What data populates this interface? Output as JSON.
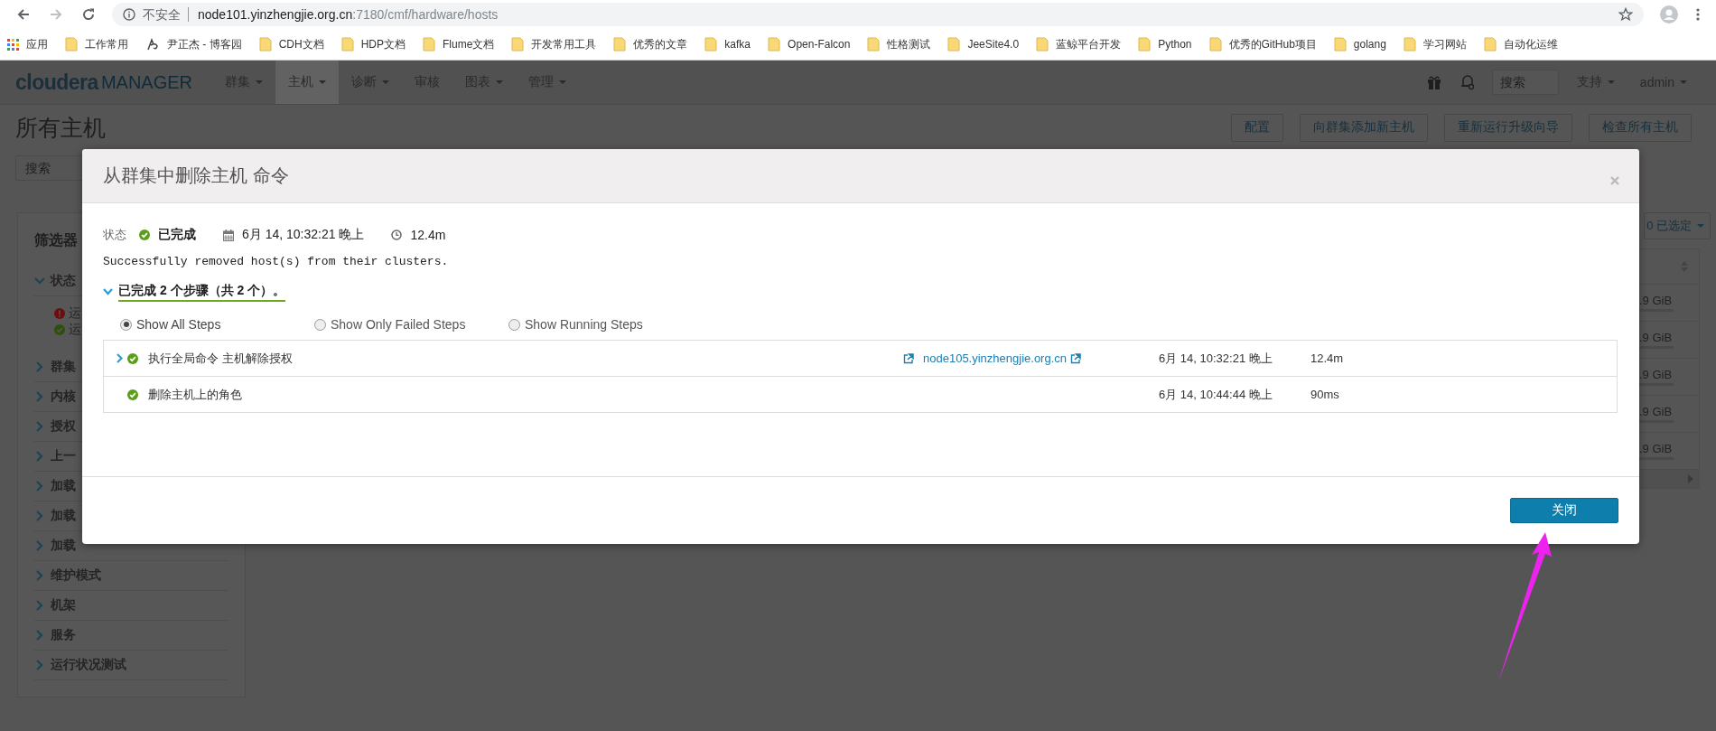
{
  "browser": {
    "address_bar": {
      "security_label": "不安全",
      "host": "node101.yinzhengjie.org.cn",
      "path": ":7180/cmf/hardware/hosts"
    },
    "bookmarks": [
      {
        "label": "应用",
        "kind": "apps"
      },
      {
        "label": "工作常用",
        "kind": "folder"
      },
      {
        "label": "尹正杰 - 博客园",
        "kind": "site"
      },
      {
        "label": "CDH文档",
        "kind": "folder"
      },
      {
        "label": "HDP文档",
        "kind": "folder"
      },
      {
        "label": "Flume文档",
        "kind": "folder"
      },
      {
        "label": "开发常用工具",
        "kind": "folder"
      },
      {
        "label": "优秀的文章",
        "kind": "folder"
      },
      {
        "label": "kafka",
        "kind": "folder"
      },
      {
        "label": "Open-Falcon",
        "kind": "folder"
      },
      {
        "label": "性格测试",
        "kind": "folder"
      },
      {
        "label": "JeeSite4.0",
        "kind": "folder"
      },
      {
        "label": "蓝鲸平台开发",
        "kind": "folder"
      },
      {
        "label": "Python",
        "kind": "folder"
      },
      {
        "label": "优秀的GitHub项目",
        "kind": "folder"
      },
      {
        "label": "golang",
        "kind": "folder"
      },
      {
        "label": "学习网站",
        "kind": "folder"
      },
      {
        "label": "自动化运维",
        "kind": "folder"
      }
    ]
  },
  "app_nav": {
    "logo": {
      "brand": "cloudera",
      "product": "MANAGER"
    },
    "items": [
      {
        "label": "群集",
        "dropdown": true,
        "selected": false
      },
      {
        "label": "主机",
        "dropdown": true,
        "selected": true
      },
      {
        "label": "诊断",
        "dropdown": true,
        "selected": false
      },
      {
        "label": "审核",
        "dropdown": false,
        "selected": false
      },
      {
        "label": "图表",
        "dropdown": true,
        "selected": false
      },
      {
        "label": "管理",
        "dropdown": true,
        "selected": false
      }
    ],
    "search": {
      "placeholder": "搜索"
    },
    "menus": [
      {
        "label": "支持"
      },
      {
        "label": "admin"
      }
    ]
  },
  "page": {
    "title": "所有主机",
    "buttons": [
      "配置",
      "向群集添加新主机",
      "重新运行升级向导",
      "检查所有主机"
    ],
    "search": {
      "placeholder": "搜索"
    }
  },
  "filters": {
    "title": "筛选器",
    "items": [
      {
        "label": "状态",
        "expanded": true,
        "children": [
          {
            "label": "运",
            "kind": "error"
          },
          {
            "label": "运",
            "kind": "ok"
          }
        ]
      },
      {
        "label": "群集",
        "expanded": false
      },
      {
        "label": "内核",
        "expanded": false
      },
      {
        "label": "授权",
        "expanded": false
      },
      {
        "label": "上一",
        "expanded": false
      },
      {
        "label": "加载",
        "expanded": false
      },
      {
        "label": "加载",
        "expanded": false
      },
      {
        "label": "加载",
        "expanded": false
      },
      {
        "label": "维护模式",
        "expanded": false
      },
      {
        "label": "机架",
        "expanded": false
      },
      {
        "label": "服务",
        "expanded": false
      },
      {
        "label": "运行状况测试",
        "expanded": false
      }
    ]
  },
  "hosts_table": {
    "selection_button": "0 已选定",
    "rows": [
      {
        "column_1": ".9 GiB"
      },
      {
        "column_1": ".9 GiB"
      },
      {
        "column_1": ".9 GiB"
      },
      {
        "column_1": ".9 GiB"
      },
      {
        "column_1": ".9 GiB"
      }
    ]
  },
  "modal": {
    "title": "从群集中删除主机 命令",
    "status": {
      "label": "状态",
      "succeeded": true,
      "value": "已完成",
      "started": "6月 14, 10:32:21 晚上",
      "duration": "12.4m"
    },
    "message": "Successfully removed host(s) from their clusters.",
    "steps_summary": {
      "text": "已完成 2 个步骤（共 2 个）。",
      "expanded": true
    },
    "step_filters": [
      {
        "label": "Show All Steps",
        "selected": true
      },
      {
        "label": "Show Only Failed Steps",
        "selected": false
      },
      {
        "label": "Show Running Steps",
        "selected": false
      }
    ],
    "steps": [
      {
        "name": "执行全局命令 主机解除授权",
        "succeeded": true,
        "expandable": true,
        "host": "node105.yinzhengjie.org.cn",
        "time": "6月 14, 10:32:21 晚上",
        "duration": "12.4m"
      },
      {
        "name": "删除主机上的角色",
        "succeeded": true,
        "expandable": false,
        "time": "6月 14, 10:44:44 晚上",
        "duration": "90ms"
      }
    ],
    "footer_button": "关闭"
  }
}
